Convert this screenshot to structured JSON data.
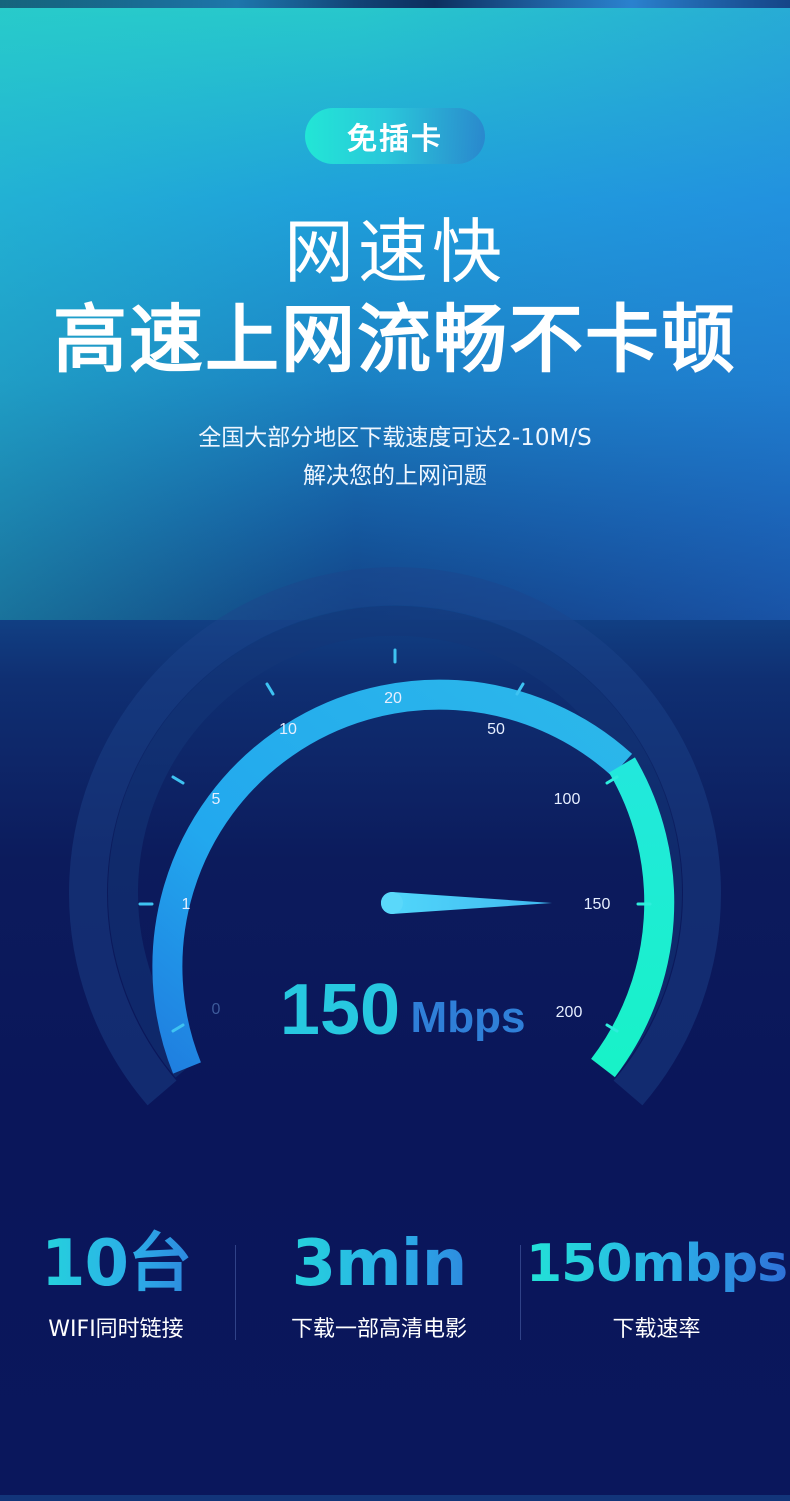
{
  "hero": {
    "badge": "免插卡",
    "title_light": "网速快",
    "title_bold": "高速上网流畅不卡顿",
    "desc_line1": "全国大部分地区下载速度可达2-10M/S",
    "desc_line2": "解决您的上网问题"
  },
  "gauge": {
    "ticks": [
      "0",
      "1",
      "5",
      "10",
      "20",
      "50",
      "100",
      "150",
      "200"
    ],
    "reading_value": "150",
    "reading_unit": "Mbps",
    "needle_value": 150,
    "colors": {
      "arc_blue": "#27b6f0",
      "arc_green": "#1ff0d6",
      "needle": "#4fd0f5",
      "value": "#27c8e0",
      "unit": "#2f7fd8"
    }
  },
  "stats": [
    {
      "value": "10台",
      "label": "WIFI同时链接"
    },
    {
      "value": "3min",
      "label": "下载一部高清电影"
    },
    {
      "value": "150mbps",
      "label": "下载速率"
    }
  ]
}
